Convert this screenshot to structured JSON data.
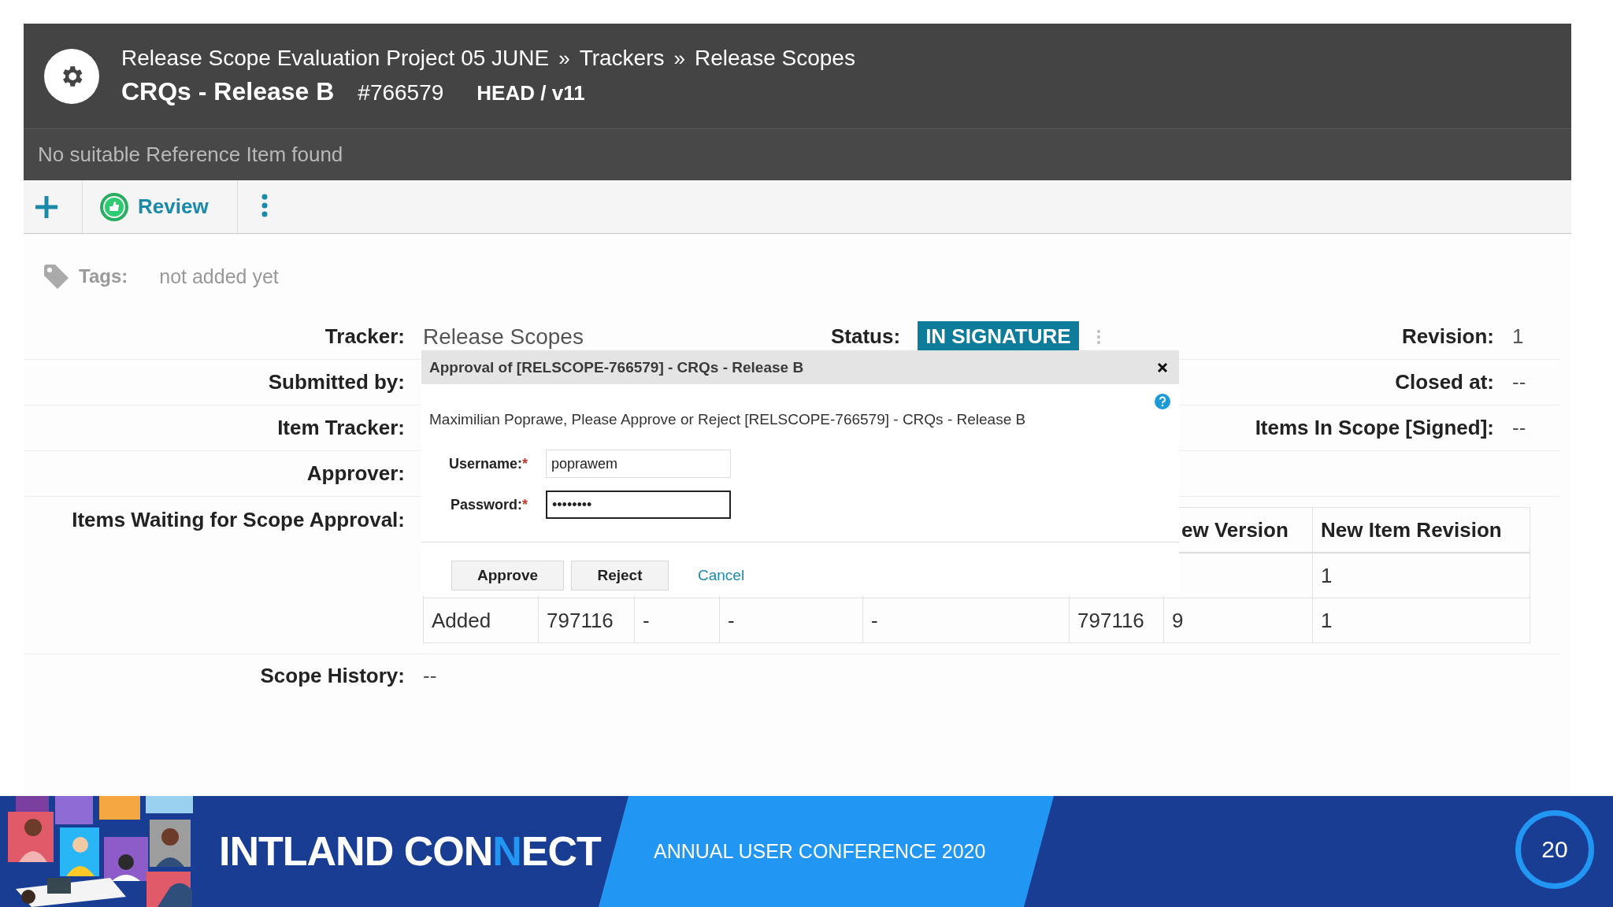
{
  "header": {
    "breadcrumb": [
      {
        "kind": "link",
        "text": "Release Scope Evaluation Project 05 JUNE"
      },
      {
        "kind": "separator",
        "text": "»"
      },
      {
        "kind": "link",
        "text": "Trackers"
      },
      {
        "kind": "separator",
        "text": "»"
      },
      {
        "kind": "link",
        "text": "Release Scopes"
      }
    ],
    "title": "CRQs - Release B",
    "item_id": "#766579",
    "version": "HEAD / v11",
    "notice": "No suitable Reference Item found"
  },
  "toolbar": {
    "review": "Review"
  },
  "tags": {
    "label": "Tags:",
    "value": "not added yet"
  },
  "fields": [
    {
      "label": "Tracker:",
      "value": "Release Scopes"
    },
    {
      "label": "Submitted by:"
    },
    {
      "label": "Item Tracker:"
    },
    {
      "label": "Approver:"
    }
  ],
  "status": {
    "label": "Status:",
    "value": "IN SIGNATURE"
  },
  "right_fields": [
    {
      "label": "Revision:",
      "value": "1"
    },
    {
      "label": "Closed at:",
      "value": "--"
    },
    {
      "label": "Items In Scope [Signed]:",
      "value": "--"
    }
  ],
  "waiting": {
    "label": "Items Waiting for Scope Approval:",
    "headers": [
      "ew Version",
      "New Item Revision"
    ],
    "rows": [
      {
        "cells": [
          "",
          "",
          "",
          "",
          "",
          "",
          "",
          "1"
        ]
      },
      {
        "cells": [
          "Added",
          "797116",
          "-",
          "-",
          "-",
          "797116",
          "9",
          "1"
        ]
      }
    ]
  },
  "scope_history": {
    "label": "Scope History:",
    "value": "--"
  },
  "dialog": {
    "title": "Approval of [RELSCOPE-766579] - CRQs - Release B",
    "message": "Maximilian Poprawe, Please Approve or Reject [RELSCOPE-766579] - CRQs - Release B",
    "fields": [
      {
        "label": "Username:",
        "required_mark": "*",
        "value": "poprawem",
        "focused": false
      },
      {
        "label": "Password:",
        "required_mark": "*",
        "value": "••••••••",
        "focused": true
      }
    ],
    "buttons": [
      {
        "kind": "button",
        "label": "Approve"
      },
      {
        "kind": "button",
        "label": "Reject"
      },
      {
        "kind": "link",
        "label": "Cancel"
      }
    ]
  },
  "footer": {
    "brand": [
      {
        "text": "INTLAND CON",
        "accent": false
      },
      {
        "text": "N",
        "accent": true
      },
      {
        "text": "ECT",
        "accent": false
      }
    ],
    "event": "ANNUAL USER CONFERENCE 2020",
    "page": "20"
  }
}
